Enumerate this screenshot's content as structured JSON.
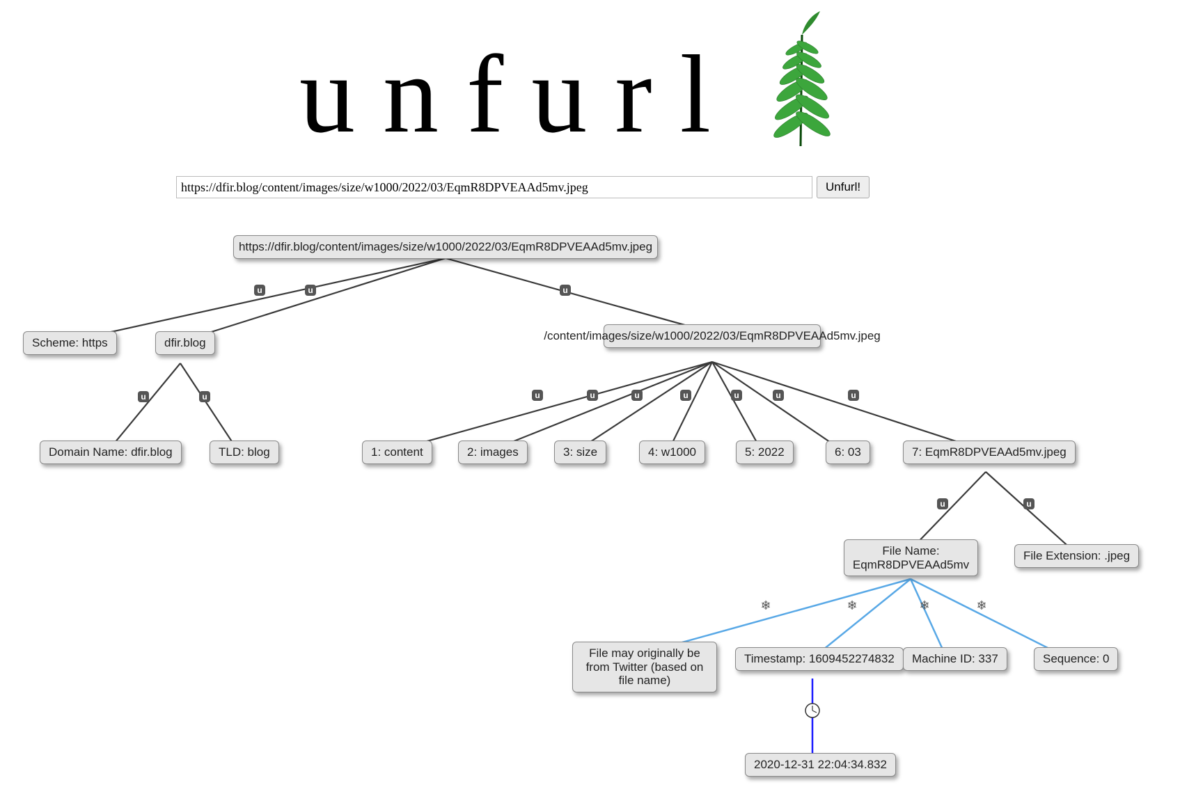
{
  "app": {
    "name": "unfurl"
  },
  "form": {
    "url_value": "https://dfir.blog/content/images/size/w1000/2022/03/EqmR8DPVEAAd5mv.jpeg",
    "button_label": "Unfurl!"
  },
  "nodes": {
    "root": "https://dfir.blog/content/images/size/w1000/2022/03/EqmR8DPVEAAd5mv.jpeg",
    "scheme": "Scheme: https",
    "host": "dfir.blog",
    "path": "/content/images/size/w1000/2022/03/EqmR8DPVEAAd5mv.jpeg",
    "domain_name": "Domain Name: dfir.blog",
    "tld": "TLD: blog",
    "seg1": "1: content",
    "seg2": "2: images",
    "seg3": "3: size",
    "seg4": "4: w1000",
    "seg5": "5: 2022",
    "seg6": "6: 03",
    "seg7": "7: EqmR8DPVEAAd5mv.jpeg",
    "file_name": "File Name:\nEqmR8DPVEAAd5mv",
    "file_ext": "File Extension: .jpeg",
    "twitter_hint": "File may originally be from Twitter (based on file name)",
    "timestamp": "Timestamp: 1609452274832",
    "machine_id": "Machine ID: 337",
    "sequence": "Sequence: 0",
    "ts_decoded": "2020-12-31 22:04:34.832"
  }
}
